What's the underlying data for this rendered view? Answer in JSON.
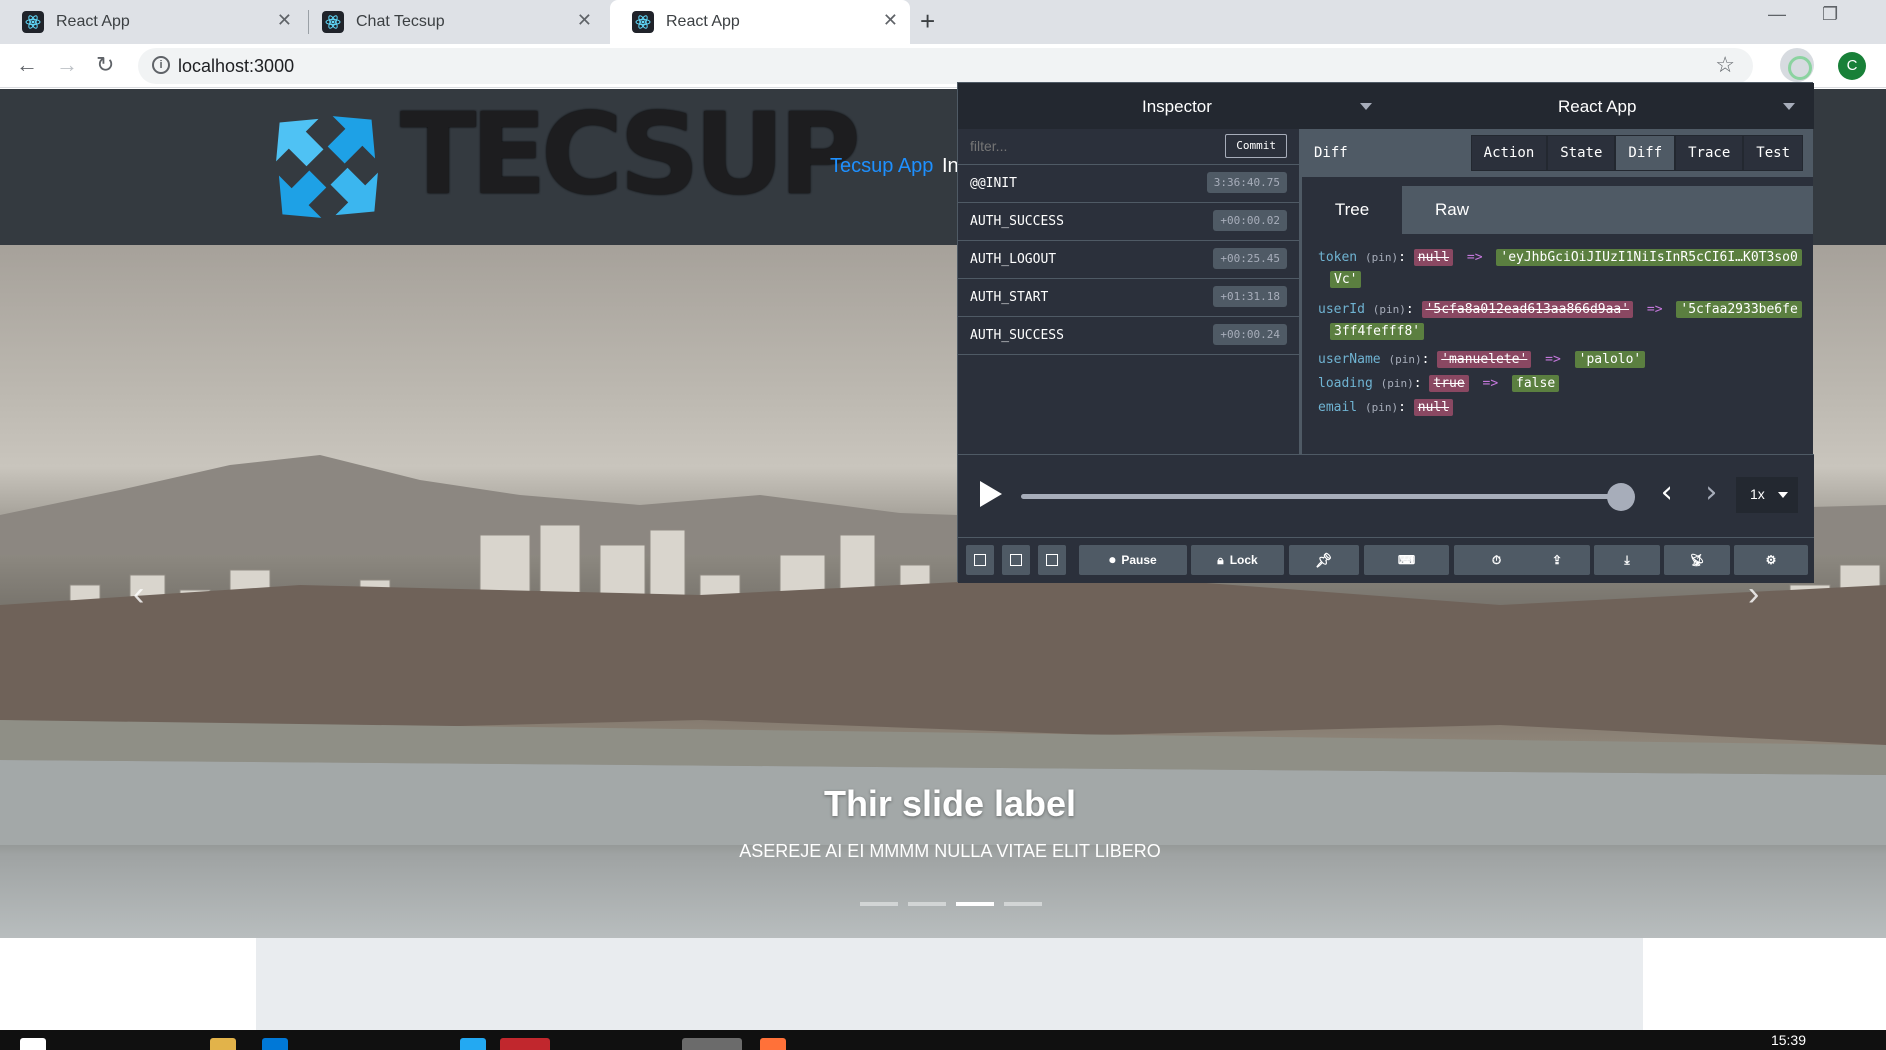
{
  "browser": {
    "tabs": [
      {
        "title": "React App"
      },
      {
        "title": "Chat Tecsup"
      },
      {
        "title": "React App",
        "active": true
      }
    ],
    "new_tab_label": "+",
    "url": "localhost:3000",
    "profile_initial": "C"
  },
  "page": {
    "logo_text": "TECSUP",
    "brand_text": "Tecsup App",
    "brand_extra": "In",
    "carousel": {
      "title": "Thir slide label",
      "description": "ASEREJE AI EI MMMM NULLA VITAE ELIT LIBERO",
      "indicator_count": 4,
      "active_indicator": 2,
      "prev_icon": "chevron-left-icon",
      "next_icon": "chevron-right-icon"
    }
  },
  "devtools": {
    "left_title": "Inspector",
    "right_title": "React App",
    "filter_placeholder": "filter...",
    "commit_label": "Commit",
    "actions": [
      {
        "name": "@@INIT",
        "time": "3:36:40.75"
      },
      {
        "name": "AUTH_SUCCESS",
        "time": "+00:00.02"
      },
      {
        "name": "AUTH_LOGOUT",
        "time": "+00:25.45"
      },
      {
        "name": "AUTH_START",
        "time": "+01:31.18"
      },
      {
        "name": "AUTH_SUCCESS",
        "time": "+00:00.24"
      }
    ],
    "monitor_label": "Diff",
    "monitor_tabs": [
      "Action",
      "State",
      "Diff",
      "Trace",
      "Test"
    ],
    "active_monitor_tab": "Diff",
    "sub_tabs": [
      "Tree",
      "Raw"
    ],
    "active_sub_tab": "Tree",
    "pin_label": "(pin)",
    "arrow": "=>",
    "diff": [
      {
        "key": "token",
        "old": "null",
        "new": "'eyJhbGciOiJIUzI1NiIsInR5cCI6I…K0T3so0",
        "new_cont": "Vc'"
      },
      {
        "key": "userId",
        "old": "'5cfa8a012ead613aa866d9aa'",
        "new": "'5cfaa2933be6fe",
        "new_cont": "3ff4fefff8'"
      },
      {
        "key": "userName",
        "old": "'manuelete'",
        "new": "'palolo'"
      },
      {
        "key": "loading",
        "old": "true",
        "new": "false"
      },
      {
        "key": "email",
        "old": "null"
      }
    ],
    "slider_fraction": 1.0,
    "speed": "1x",
    "buttons": {
      "pause": "Pause",
      "lock": "Lock"
    }
  },
  "taskbar": {
    "time": "15:39"
  },
  "colors": {
    "devtools_bg": "#2b303b",
    "devtools_key": "#6fb3d2",
    "diff_removed": "#8a4862",
    "diff_added": "#5b7f40",
    "header_bg": "#343a40",
    "brand_link": "#1e90ff"
  }
}
